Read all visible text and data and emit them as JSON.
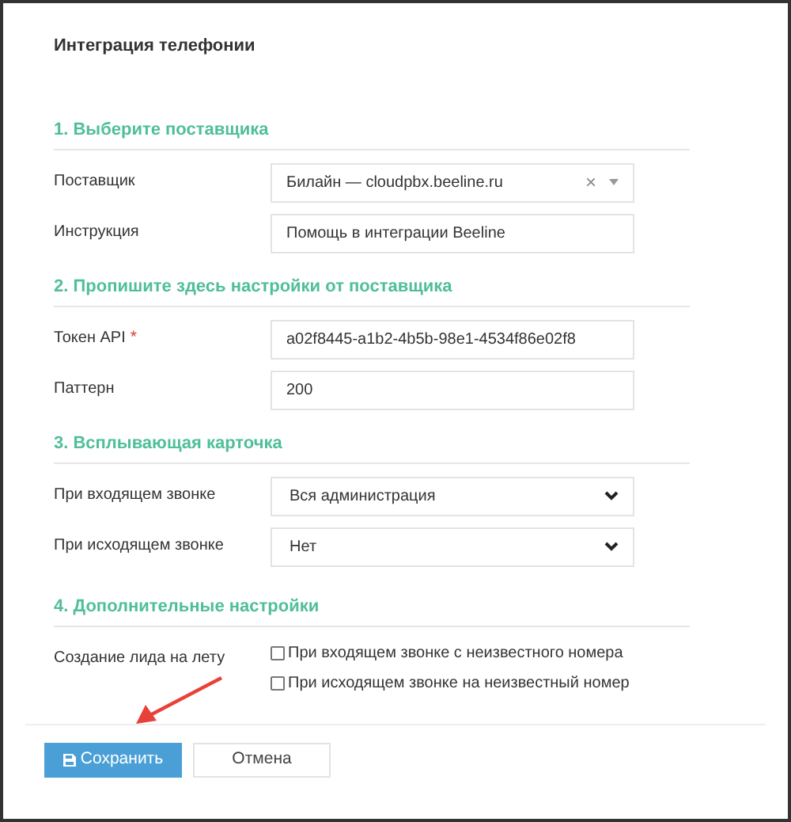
{
  "title": "Интеграция телефонии",
  "sections": [
    {
      "heading": "1. Выберите поставщика",
      "fields": [
        {
          "kind": "combo",
          "label": "Поставщик",
          "value": "Билайн — cloudpbx.beeline.ru",
          "clear": "×"
        },
        {
          "kind": "text",
          "label": "Инструкция",
          "value": "Помощь в интеграции Beeline"
        }
      ]
    },
    {
      "heading": "2. Пропишите здесь настройки от поставщика",
      "fields": [
        {
          "kind": "text",
          "label": "Токен API",
          "value": "a02f8445-a1b2-4b5b-98e1-4534f86e02f8",
          "mark": "*"
        },
        {
          "kind": "text",
          "label": "Паттерн",
          "value": "200"
        }
      ]
    },
    {
      "heading": "3. Всплывающая карточка",
      "fields": [
        {
          "kind": "select",
          "label": "При входящем звонке",
          "value": "Вся администрация"
        },
        {
          "kind": "select",
          "label": "При исходящем звонке",
          "value": "Нет"
        }
      ]
    },
    {
      "heading": "4. Дополнительные настройки",
      "fields": [
        {
          "kind": "checks",
          "label": "Создание лида на лету",
          "options": [
            {
              "label": "При входящем звонке с неизвестного номера",
              "checked": false
            },
            {
              "label": "При исходящем звонке на неизвестный номер",
              "checked": false
            }
          ]
        }
      ]
    }
  ],
  "buttons": [
    {
      "kind": "primary",
      "label": "Сохранить"
    },
    {
      "kind": "secondary",
      "label": "Отмена"
    }
  ]
}
